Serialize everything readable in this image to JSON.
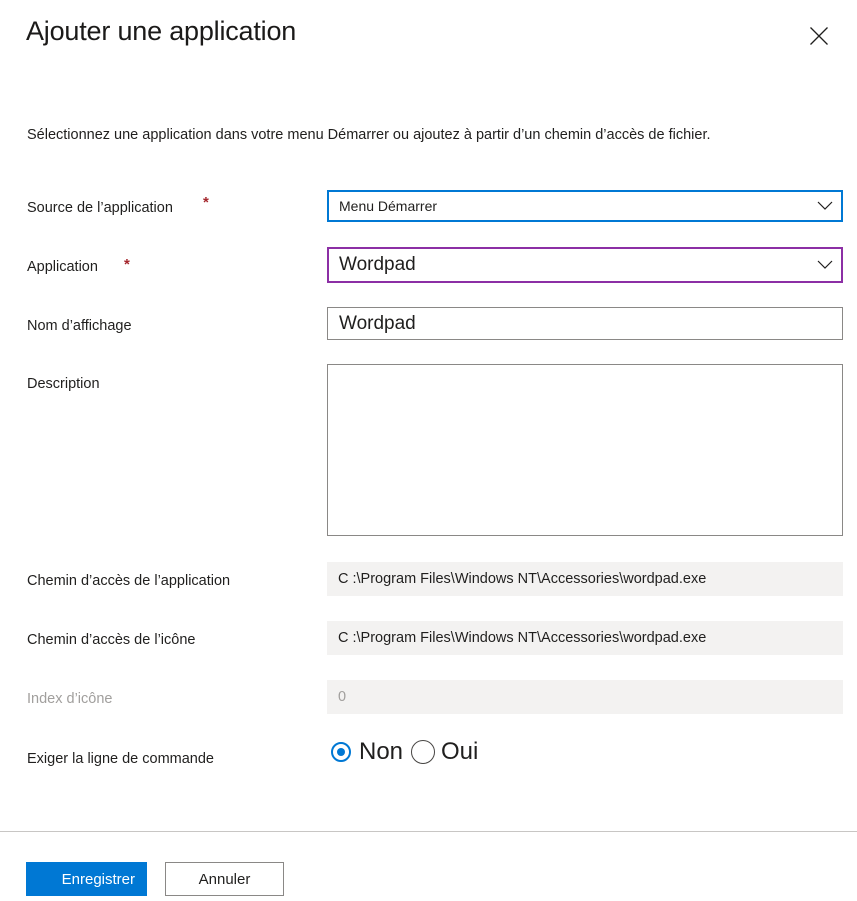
{
  "panel": {
    "title": "Ajouter une application",
    "close_icon": "close-icon",
    "description": "Sélectionnez une application dans votre menu Démarrer ou ajoutez à partir d’un chemin d’accès de fichier."
  },
  "form": {
    "app_source": {
      "label": "Source de l’application",
      "required_marker": "*",
      "value": "Menu Démarrer",
      "caret_icon": "chevron-down-icon",
      "border_color": "#0078d4"
    },
    "application": {
      "label": "Application",
      "required_marker": "*",
      "value": "Wordpad",
      "caret_icon": "chevron-down-icon",
      "border_color": "#8c2fa5"
    },
    "display_name": {
      "label": "Nom d’affichage",
      "value": "Wordpad"
    },
    "description_field": {
      "label": "Description",
      "value": ""
    },
    "app_path": {
      "label": "Chemin d’accès de l’application",
      "value": "C :\\Program Files\\Windows NT\\Accessories\\wordpad.exe"
    },
    "icon_path": {
      "label": "Chemin d’accès de l’icône",
      "value": "C :\\Program Files\\Windows NT\\Accessories\\wordpad.exe"
    },
    "icon_index": {
      "label": "Index d’icône",
      "value": "0"
    },
    "require_command_line": {
      "label": "Exiger la ligne de commande",
      "options": [
        {
          "label": "Non",
          "selected": true
        },
        {
          "label": "Oui",
          "selected": false
        }
      ]
    }
  },
  "footer": {
    "save_label": "Enregistrer",
    "cancel_label": "Annuler",
    "save_color": "#0078d4"
  }
}
